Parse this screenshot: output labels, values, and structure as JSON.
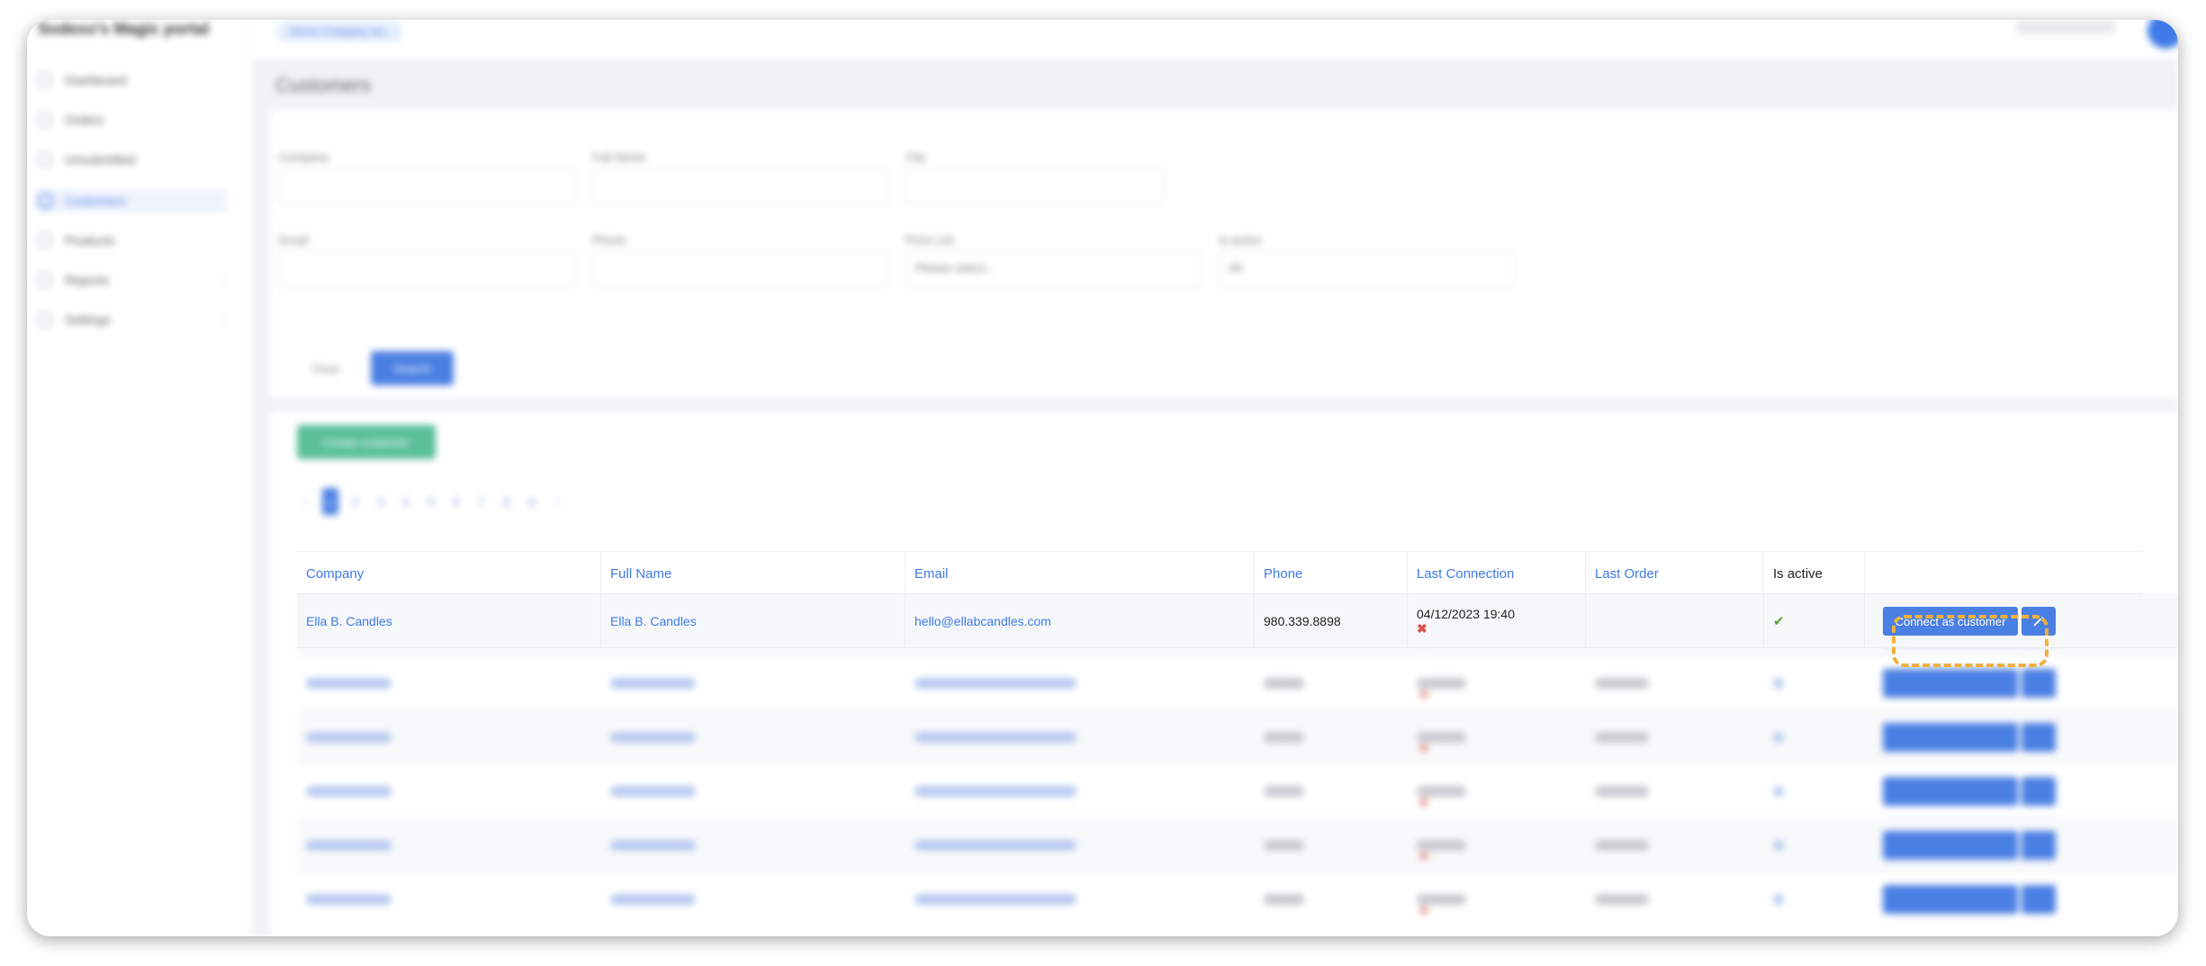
{
  "app": {
    "brand": "Sodexo's Magic portal"
  },
  "sidebar": {
    "items": [
      {
        "label": "Dashboard"
      },
      {
        "label": "Orders"
      },
      {
        "label": "Unsubmitted"
      },
      {
        "label": "Customers"
      },
      {
        "label": "Products"
      },
      {
        "label": "Reports"
      },
      {
        "label": "Settings"
      }
    ]
  },
  "header": {
    "pill": "Demo Company Inc.",
    "menu": "Support"
  },
  "page": {
    "title": "Customers"
  },
  "filters": {
    "company_label": "Company",
    "fullname_label": "Full Name",
    "city_label": "City",
    "email_label": "Email",
    "phone_label": "Phone",
    "price_list_label": "Price List",
    "price_list_value": "Please select...",
    "is_active_label": "Is active",
    "is_active_value": "All",
    "clear_label": "Clear",
    "search_label": "Search"
  },
  "list": {
    "create_label": "Create customer",
    "pages": [
      "‹",
      "1",
      "2",
      "3",
      "4",
      "5",
      "6",
      "7",
      "8",
      "9",
      "›"
    ]
  },
  "table": {
    "columns": {
      "company": "Company",
      "full_name": "Full Name",
      "email": "Email",
      "phone": "Phone",
      "last_connection": "Last Connection",
      "last_order": "Last Order",
      "is_active": "Is active"
    },
    "rows": [
      {
        "company": "Ella B. Candles",
        "full_name": "Ella B. Candles",
        "email": "hello@ellabcandles.com",
        "phone": "980.339.8898",
        "last_connection": "04/12/2023 19:40",
        "last_order": "",
        "connect_label": "Connect as customer"
      }
    ]
  },
  "icons": {
    "edit": "pencil-icon",
    "not_connected": "close-icon",
    "active": "check-icon"
  },
  "colors": {
    "accent": "#3f7ae8",
    "highlight": "#f0b13a",
    "success": "#5c9e3a",
    "danger": "#d9534f"
  }
}
